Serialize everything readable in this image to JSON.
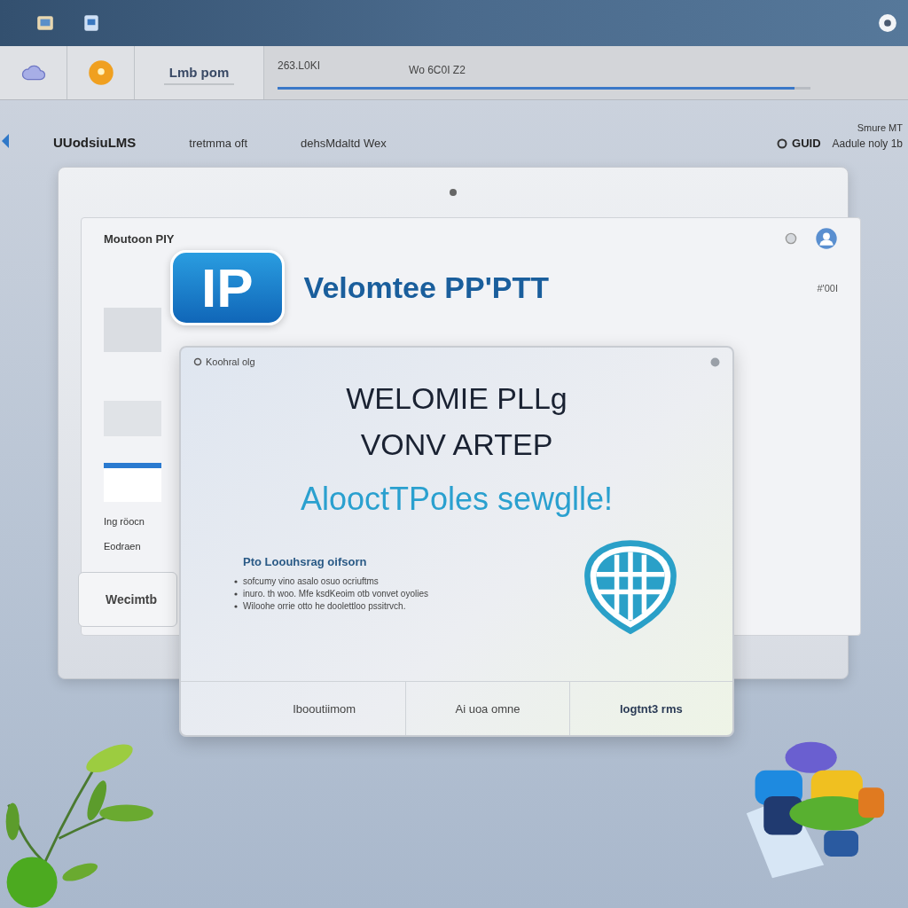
{
  "toolbar": {
    "button": "Lmb pom",
    "status_label": "263.L0KI",
    "status_text": "Wo 6C0I Z2",
    "progress": {
      "level": 0.97
    }
  },
  "header_row": {
    "items": [
      "UUodsiuLMS",
      "tretmma oft",
      "dehsMdaltd Wex"
    ],
    "corner_text": "Smure MT",
    "option": "GUID",
    "option_note": "Aadule noly 1b"
  },
  "back_window": {
    "panel_title": "Moutoon PIY",
    "logo_text": "IP",
    "heading": "Velomtee PP'PTT",
    "corner_text": "#'00I",
    "side_lines": [
      "Ing röocn",
      "Eodraen"
    ],
    "button": "Wecimtb"
  },
  "dialog": {
    "title": "Koohral olg",
    "headlines": [
      "WELOMIE PLLg",
      "VONV ARTEP"
    ],
    "tagline": "AlooctTPoles sewglle!",
    "section_title": "Pto Loouhsrag oifsorn",
    "bullets": [
      "sofcumy vino asalo osuo ocriuftms",
      "inuro. th woo. Mfe ksdKeoim otb vonvet oyolies",
      "Wiloohe orrie otto he doolettloo pssitrvch."
    ],
    "buttons": [
      {
        "label": "Ibooutiimom",
        "primary": false
      },
      {
        "label": "Ai uoa omne",
        "primary": false
      },
      {
        "label": "logtnt3 rms",
        "primary": true
      }
    ]
  }
}
